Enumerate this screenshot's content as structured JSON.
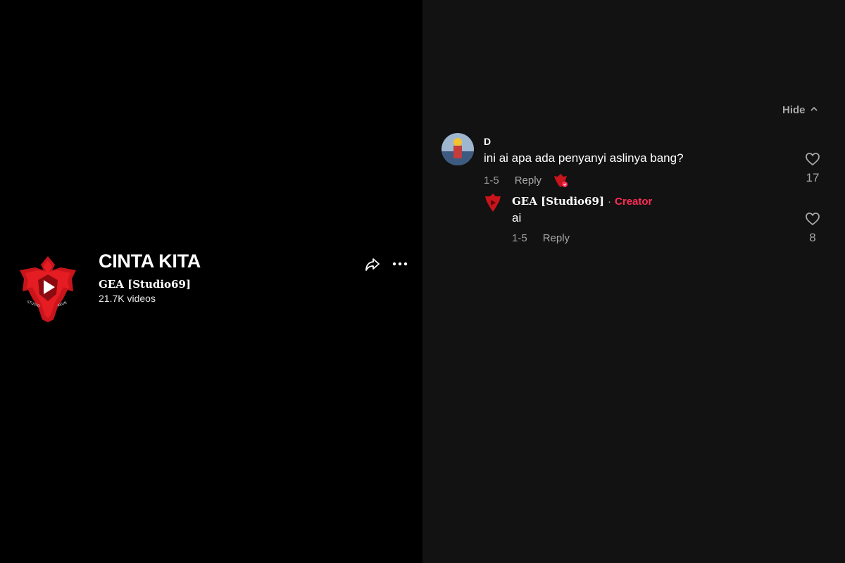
{
  "sound": {
    "title": "CINTA KITA",
    "author": "GEA [Studio69]",
    "video_count": "21.7K videos",
    "logo_icon": "gea-studio-logo-icon",
    "share_icon": "share-arrow-icon",
    "more_icon": "more-horizontal-icon"
  },
  "comments_panel": {
    "hide_label": "Hide",
    "hide_icon": "chevron-up-icon",
    "comments": [
      {
        "username": "D",
        "text": "ini ai apa ada penyanyi aslinya bang?",
        "date": "1-5",
        "reply_label": "Reply",
        "likes": "17"
      }
    ],
    "replies": [
      {
        "username": "GEA [Studio69]",
        "separator": "·",
        "badge": "Creator",
        "text": "ai",
        "date": "1-5",
        "reply_label": "Reply",
        "likes": "8"
      }
    ]
  },
  "colors": {
    "left_bg": "#000000",
    "right_bg": "#121212",
    "accent": "#fe2c55",
    "muted_text": "#a8a8a8"
  }
}
